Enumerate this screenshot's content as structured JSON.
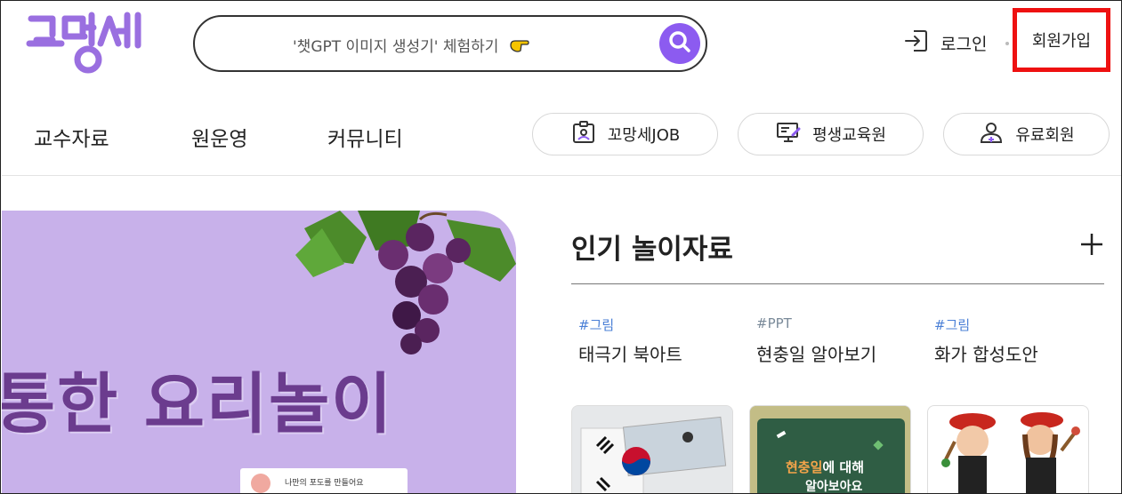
{
  "header": {
    "logo_text": "꼬망세",
    "search_text": "'챗GPT 이미지 생성기' 체험하기",
    "login_label": "로그인",
    "signup_label": "회원가입"
  },
  "nav": {
    "items": [
      "교수자료",
      "원운영",
      "커뮤니티"
    ],
    "pills": [
      "꼬망세JOB",
      "평생교육원",
      "유료회원"
    ]
  },
  "banner": {
    "title": "통한 요리놀이",
    "card_text": "나만의 포도를 만들어요"
  },
  "popular": {
    "title": "인기 놀이자료",
    "items": [
      {
        "tag": "#그림",
        "title": "태극기 북아트"
      },
      {
        "tag": "#PPT",
        "title": "현충일 알아보기"
      },
      {
        "tag": "#그림",
        "title": "화가 합성도안"
      }
    ],
    "thumb2_line1_highlight": "현충일",
    "thumb2_line1_rest": "에 대해",
    "thumb2_line2": "알아보아요"
  },
  "colors": {
    "brand_purple": "#8c5bf0",
    "logo_purple": "#9a6fe0",
    "highlight_red": "#ee1111",
    "tag_blue": "#4a7fd6",
    "tag_gray": "#7a8a99",
    "banner_bg": "#c8b1ea"
  },
  "icons": {
    "search": "search-icon",
    "pointing_hand": "pointing-hand-icon",
    "login": "login-icon",
    "job": "id-card-icon",
    "edu": "monitor-pen-icon",
    "member": "user-plus-icon",
    "plus": "plus-icon"
  }
}
